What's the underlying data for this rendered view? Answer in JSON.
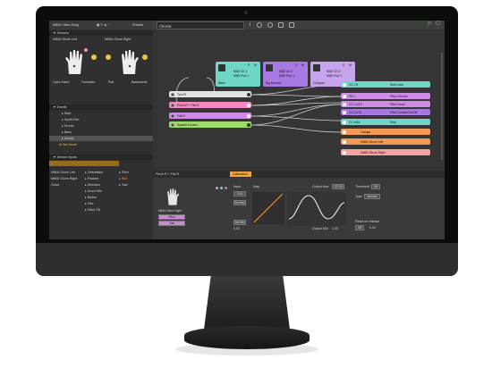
{
  "left_panel": {
    "project": "MiMU Video Song",
    "presets_label": "Presets",
    "sections": {
      "sensors": "Sensors",
      "events": "Events",
      "sensor_inputs": "Sensor Inputs"
    },
    "gloves": [
      {
        "name": "MiMU Glove Left",
        "pose_left": "Open Hand",
        "pose_right": "Forwards"
      },
      {
        "name": "MiMU Glove Right",
        "pose_left": "Flat",
        "pose_right": "Backwards"
      }
    ],
    "events": [
      "Start",
      "Synth Pan",
      "Drums",
      "Bass",
      "Vocals",
      "Set Scroll"
    ],
    "selected_event": "Vocals",
    "inputs_col1": [
      "MiMU Glove Left",
      "MiMU Glove Right",
      "Glove"
    ],
    "inputs_col2": [
      "Orientation",
      "Posture",
      "Direction",
      "Drum Hits",
      "Button",
      "Flex",
      "Palm Tilt"
    ],
    "inputs_col3": [
      "Pitch",
      "Roll",
      "Yaw"
    ]
  },
  "toolbar": {
    "search_value": "Chords",
    "icons": [
      "cursor-icon",
      "circle-icon",
      "info-icon",
      "piano-icon",
      "grid-icon"
    ],
    "right_icons": [
      "p-icon",
      "power-icon"
    ]
  },
  "canvas": {
    "top_blocks": [
      {
        "title": "Bass",
        "line1": "MIDI Ch 1",
        "line2": "MIDI Port 1",
        "color": "#6fd6c8",
        "s_label": "S",
        "m_label": "M"
      },
      {
        "title": "Big Bounce",
        "line1": "MIDI Ch 2",
        "line2": "MIDI Port 1",
        "color": "#a879e0",
        "s_label": "S",
        "m_label": "M"
      },
      {
        "title": "Chopper",
        "line1": "MIDI Ch 3",
        "line2": "MIDI Port 1",
        "color": "#c9a4ee",
        "s_label": "S",
        "m_label": "M"
      }
    ],
    "left_nodes": [
      {
        "label": "Toro R",
        "color": "#e2e2e2"
      },
      {
        "label": "Pinch R + Fist R",
        "color": "#f18ac1"
      },
      {
        "label": "Fist R",
        "color": "#d08be6"
      },
      {
        "label": "System Drone L",
        "color": "#9edc6a"
      }
    ],
    "right_nodes": [
      {
        "label": "CC 7/1",
        "label2": "Shift Lock",
        "color": "#6fd6c8"
      },
      {
        "label": "PB 1",
        "label2": "Pitch Chords",
        "color": "#d08be6"
      },
      {
        "label": "CC 12/13",
        "label2": "Pitch Vocal",
        "color": "#d08be6"
      },
      {
        "label": "CC 11/15",
        "label2": "Pitch Control On/Off",
        "color": "#a879e0"
      },
      {
        "label": "CC 6/16",
        "label2": "Skip",
        "color": "#6fd6c8"
      },
      {
        "label": "Orange",
        "label2": "",
        "color": "#f39b56"
      },
      {
        "label": "MiMU Glove Left",
        "label2": "",
        "color": "#f39b56"
      },
      {
        "label": "MiMU Glove Right",
        "label2": "",
        "color": "#f6a3a0"
      }
    ]
  },
  "bottom": {
    "title": "Pinch R + Fist R",
    "tab": "Calibration",
    "glove_label": "MiMU Glove Right",
    "mini_buttons": [
      "Pitch",
      "Yaw"
    ],
    "input_label": "Input",
    "input_value": "1.00",
    "set_max": "Set Max",
    "set_min": "Set Min",
    "map_label": "Map",
    "output_max_label": "Output Max",
    "output_max_value": "127.00",
    "output_min_label": "Output Min",
    "output_min_value": "0.00",
    "threshold_label": "Threshold",
    "threshold_value": "Off",
    "type_label": "Type",
    "type_value": "Normal",
    "reset_label": "Reset on release",
    "reset_value": "Off",
    "reset_num": "0.00",
    "input_min": "0.00"
  }
}
